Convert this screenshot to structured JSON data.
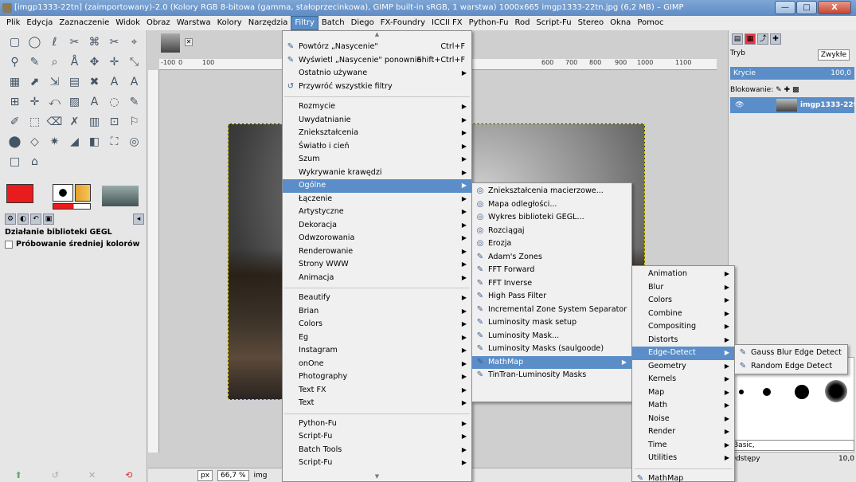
{
  "window": {
    "title": "[imgp1333-22tn] (zaimportowany)-2.0 (Kolory RGB 8-bitowa (gamma, stałoprzecinkowa), GIMP built-in sRGB, 1 warstwa) 1000x665 imgp1333-22tn.jpg (6,2 MB) – GIMP",
    "minimize": "—",
    "maximize": "□",
    "close": "X"
  },
  "menubar": [
    "Plik",
    "Edycja",
    "Zaznaczenie",
    "Widok",
    "Obraz",
    "Warstwa",
    "Kolory",
    "Narzędzia",
    "Filtry",
    "Batch",
    "Diego",
    "FX-Foundry",
    "ICCII FX",
    "Python-Fu",
    "Rod",
    "Script-Fu",
    "Stereo",
    "Okna",
    "Pomoc"
  ],
  "toolbox": {
    "tools": [
      "▢",
      "◯",
      "ℓ",
      "✂",
      "⌘",
      "✂",
      "⌖",
      "⚲",
      "✎",
      "⌕",
      "Å",
      "✥",
      "✛",
      "⤡",
      "▦",
      "⬈",
      "⇲",
      "▤",
      "✖",
      "A",
      "A",
      "⊞",
      "✛",
      "⤺",
      "▨",
      "A",
      "◌",
      "✎",
      "✐",
      "⬚",
      "⌫",
      "✗",
      "▥",
      "⊡",
      "⚐",
      "⬤",
      "◇",
      "✷",
      "◢",
      "◧",
      "⛶",
      "◎",
      "□",
      "⌂"
    ],
    "tool_names": [
      "rect-select-icon",
      "ellipse-select-icon",
      "free-select-icon",
      "fuzzy-select-icon",
      "color-select-icon",
      "scissors-icon",
      "foreground-select-icon",
      "paths-icon",
      "color-picker-icon",
      "zoom-icon",
      "measure-icon",
      "move-icon",
      "align-icon",
      "crop-icon",
      "rotate-icon",
      "scale-icon",
      "shear-icon",
      "perspective-icon",
      "flip-icon",
      "cage-icon",
      "text-icon",
      "warp-icon",
      "unified-transform-icon",
      "handle-transform-icon",
      "bucket-fill-icon",
      "blend-icon",
      "pencil-icon",
      "paintbrush-icon",
      "eraser-icon",
      "airbrush-icon",
      "ink-icon",
      "mypaint-icon",
      "clone-icon",
      "heal-icon",
      "perspective-clone-icon",
      "blur-icon",
      "smudge-icon",
      "dodge-icon",
      "burn-icon",
      "color-swatch-icon",
      "brush-preview-icon",
      "pattern-icon",
      "gradient-icon",
      "image-icon"
    ],
    "fg_color": "#e81c1c",
    "bg_color": "#ffffff",
    "options_title": "Działanie biblioteki GEGL",
    "options_checkbox": "Próbowanie średniej kolorów"
  },
  "canvas": {
    "ruler_ticks": [
      "-100",
      "0",
      "100",
      "600",
      "700",
      "800",
      "900",
      "1000",
      "1100"
    ],
    "unit": "px",
    "zoom": "66,7 %",
    "status_tail": "img"
  },
  "dock": {
    "mode_label": "Tryb",
    "mode_value": "Zwykłe",
    "opacity_label": "Krycie",
    "opacity_value": "100,0",
    "lock_label": "Blokowanie:",
    "layer_name": "imgp1333-22tn",
    "brush_preset": "Basic,",
    "spacing_label": "Odstępy",
    "spacing_value": "10,0"
  },
  "filters_menu": {
    "top": [
      {
        "label": "Powtórz „Nasycenie\"",
        "accel": "Ctrl+F",
        "icon": "repeat-icon"
      },
      {
        "label": "Wyświetl „Nasycenie\" ponownie",
        "accel": "Shift+Ctrl+F",
        "icon": "reshow-icon"
      },
      {
        "label": "Ostatnio używane",
        "submenu": true
      },
      {
        "label": "Przywróć wszystkie filtry",
        "icon": "reset-icon"
      }
    ],
    "groups": [
      [
        "Rozmycie",
        "Uwydatnianie",
        "Zniekształcenia",
        "Światło i cień",
        "Szum",
        "Wykrywanie krawędzi",
        "Ogólne",
        "Łączenie",
        "Artystyczne",
        "Dekoracja",
        "Odwzorowania",
        "Renderowanie",
        "Strony WWW",
        "Animacja"
      ],
      [
        "Beautify",
        "Brian",
        "Colors",
        "Eg",
        "Instagram",
        "onOne",
        "Photography",
        "Text FX",
        "Text"
      ],
      [
        "Python-Fu",
        "Script-Fu",
        "Batch Tools",
        "Script-Fu"
      ]
    ],
    "highlighted": "Ogólne"
  },
  "general_submenu": {
    "items": [
      "Zniekształcenia macierzowe...",
      "Mapa odległości...",
      "Wykres biblioteki GEGL...",
      "Rozciągaj",
      "Erozja",
      "Adam's Zones",
      "FFT Forward",
      "FFT Inverse",
      "High Pass Filter",
      "Incremental Zone System Separator",
      "Luminosity mask setup",
      "Luminosity Mask...",
      "Luminosity Masks (saulgoode)",
      "MathMap",
      "TinTran-Luminosity Masks"
    ],
    "highlighted": "MathMap"
  },
  "mathmap_submenu": {
    "items": [
      "Animation",
      "Blur",
      "Colors",
      "Combine",
      "Compositing",
      "Distorts",
      "Edge-Detect",
      "Geometry",
      "Kernels",
      "Map",
      "Math",
      "Noise",
      "Render",
      "Time",
      "Utilities"
    ],
    "bottom": "MathMap",
    "highlighted": "Edge-Detect"
  },
  "edge_submenu": {
    "items": [
      "Gauss Blur Edge Detect",
      "Random Edge Detect"
    ]
  }
}
